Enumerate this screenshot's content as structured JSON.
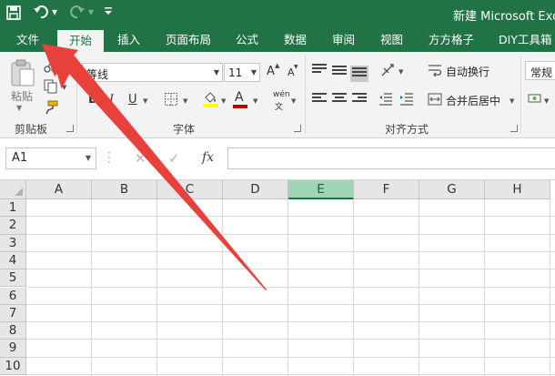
{
  "window": {
    "title": "新建 Microsoft Exce"
  },
  "tabs": [
    {
      "label": "文件"
    },
    {
      "label": "开始"
    },
    {
      "label": "插入"
    },
    {
      "label": "页面布局"
    },
    {
      "label": "公式"
    },
    {
      "label": "数据"
    },
    {
      "label": "审阅"
    },
    {
      "label": "视图"
    },
    {
      "label": "方方格子"
    },
    {
      "label": "DIY工具箱"
    }
  ],
  "ribbon": {
    "clipboard": {
      "paste_label": "粘贴",
      "group_label": "剪贴板"
    },
    "font": {
      "font_name": "等线",
      "font_size": "11",
      "grow_label": "A",
      "shrink_label": "A",
      "bold": "B",
      "italic": "I",
      "underline": "U",
      "font_color_label": "A",
      "phonetic_label": "wén",
      "group_label": "字体"
    },
    "alignment": {
      "wrap_text": "自动换行",
      "merge_center": "合并后居中",
      "group_label": "对齐方式"
    },
    "number": {
      "format": "常规"
    }
  },
  "formula_bar": {
    "name_box": "A1",
    "fx_label": "fx",
    "cancel_symbol": "✕",
    "enter_symbol": "✓",
    "formula": ""
  },
  "sheet": {
    "columns": [
      "A",
      "B",
      "C",
      "D",
      "E",
      "F",
      "G",
      "H"
    ],
    "rows": [
      "1",
      "2",
      "3",
      "4",
      "5",
      "6",
      "7",
      "8",
      "9",
      "10"
    ],
    "selected_column": "E"
  },
  "colors": {
    "accent": "#217346",
    "annotation_arrow": "#e8413c"
  }
}
